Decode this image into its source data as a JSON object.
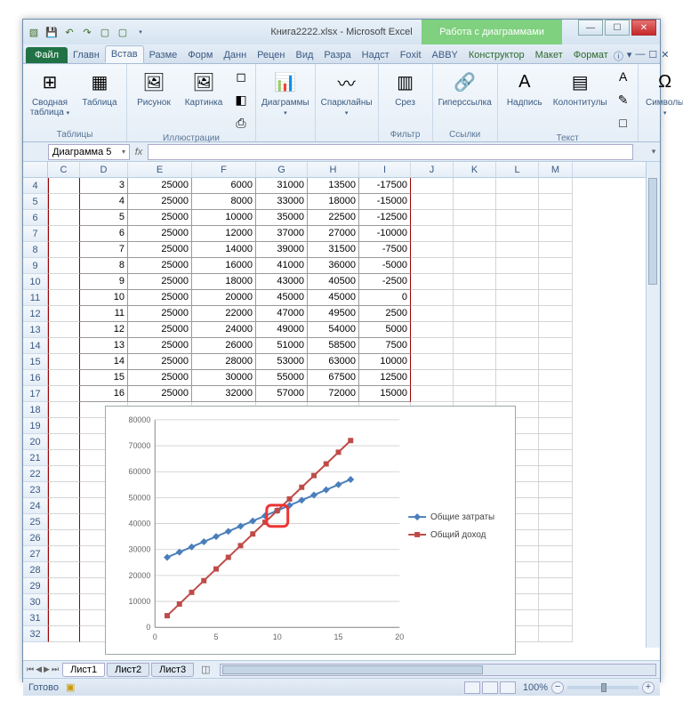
{
  "window": {
    "doc_title": "Книга2222.xlsx - Microsoft Excel",
    "chart_context": "Работа с диаграммами"
  },
  "tabs": {
    "file": "Файл",
    "items": [
      "Главн",
      "Встав",
      "Разме",
      "Форм",
      "Данн",
      "Рецен",
      "Вид",
      "Разра",
      "Надст",
      "Foxit",
      "ABBY"
    ],
    "context": [
      "Конструктор",
      "Макет",
      "Формат"
    ],
    "active_index": 1
  },
  "ribbon": {
    "groups": [
      {
        "label": "Таблицы",
        "items": [
          {
            "name": "pivot",
            "label": "Сводная\nтаблица",
            "icon": "⊞",
            "drop": true
          },
          {
            "name": "table",
            "label": "Таблица",
            "icon": "▦"
          }
        ]
      },
      {
        "label": "Иллюстрации",
        "items": [
          {
            "name": "picture",
            "label": "Рисунок",
            "icon": "🖼"
          },
          {
            "name": "clipart",
            "label": "Картинка",
            "icon": "🖼"
          },
          {
            "name": "shapes",
            "label": "",
            "icon": "◻",
            "small": true
          },
          {
            "name": "smartart",
            "label": "",
            "icon": "◧",
            "small": true
          },
          {
            "name": "screenshot",
            "label": "",
            "icon": "⎙",
            "small": true
          }
        ]
      },
      {
        "label": "",
        "items": [
          {
            "name": "charts",
            "label": "Диаграммы",
            "icon": "📊",
            "drop": true
          }
        ]
      },
      {
        "label": "",
        "items": [
          {
            "name": "sparklines",
            "label": "Спарклайны",
            "icon": "〰",
            "drop": true
          }
        ]
      },
      {
        "label": "Фильтр",
        "items": [
          {
            "name": "slicer",
            "label": "Срез",
            "icon": "▥"
          }
        ]
      },
      {
        "label": "Ссылки",
        "items": [
          {
            "name": "hyperlink",
            "label": "Гиперссылка",
            "icon": "🔗"
          }
        ]
      },
      {
        "label": "Текст",
        "items": [
          {
            "name": "textbox",
            "label": "Надпись",
            "icon": "A"
          },
          {
            "name": "headerfooter",
            "label": "Колонтитулы",
            "icon": "▤"
          },
          {
            "name": "wordart",
            "label": "",
            "icon": "A",
            "small": true
          },
          {
            "name": "sigline",
            "label": "",
            "icon": "✎",
            "small": true
          },
          {
            "name": "object",
            "label": "",
            "icon": "□",
            "small": true
          }
        ]
      },
      {
        "label": "",
        "items": [
          {
            "name": "symbols",
            "label": "Символы",
            "icon": "Ω",
            "drop": true
          }
        ]
      }
    ]
  },
  "namebox": "Диаграмма 5",
  "sheet": {
    "columns": [
      "C",
      "D",
      "E",
      "F",
      "G",
      "H",
      "I",
      "J",
      "K",
      "L",
      "M"
    ],
    "col_classes": [
      "w-C",
      "w-D",
      "w-E",
      "w-F",
      "w-G",
      "w-H",
      "w-I",
      "w-J",
      "w-K",
      "w-L",
      "w-M"
    ],
    "first_row": 4,
    "data_rows": [
      [
        null,
        3,
        25000,
        6000,
        31000,
        13500,
        -17500
      ],
      [
        null,
        4,
        25000,
        8000,
        33000,
        18000,
        -15000
      ],
      [
        null,
        5,
        25000,
        10000,
        35000,
        22500,
        -12500
      ],
      [
        null,
        6,
        25000,
        12000,
        37000,
        27000,
        -10000
      ],
      [
        null,
        7,
        25000,
        14000,
        39000,
        31500,
        -7500
      ],
      [
        null,
        8,
        25000,
        16000,
        41000,
        36000,
        -5000
      ],
      [
        null,
        9,
        25000,
        18000,
        43000,
        40500,
        -2500
      ],
      [
        null,
        10,
        25000,
        20000,
        45000,
        45000,
        0
      ],
      [
        null,
        11,
        25000,
        22000,
        47000,
        49500,
        2500
      ],
      [
        null,
        12,
        25000,
        24000,
        49000,
        54000,
        5000
      ],
      [
        null,
        13,
        25000,
        26000,
        51000,
        58500,
        7500
      ],
      [
        null,
        14,
        25000,
        28000,
        53000,
        63000,
        10000
      ],
      [
        null,
        15,
        25000,
        30000,
        55000,
        67500,
        12500
      ],
      [
        null,
        16,
        25000,
        32000,
        57000,
        72000,
        15000
      ]
    ],
    "blank_rows_after": 15,
    "tabs": [
      "Лист1",
      "Лист2",
      "Лист3"
    ],
    "active_tab": 0
  },
  "chart_data": {
    "type": "line",
    "x": [
      1,
      2,
      3,
      4,
      5,
      6,
      7,
      8,
      9,
      10,
      11,
      12,
      13,
      14,
      15,
      16
    ],
    "series": [
      {
        "name": "Общие затраты",
        "values": [
          27000,
          29000,
          31000,
          33000,
          35000,
          37000,
          39000,
          41000,
          43000,
          45000,
          47000,
          49000,
          51000,
          53000,
          55000,
          57000
        ],
        "color": "#4a7ebb",
        "marker": "diamond"
      },
      {
        "name": "Общий доход",
        "values": [
          4500,
          9000,
          13500,
          18000,
          22500,
          27000,
          31500,
          36000,
          40500,
          45000,
          49500,
          54000,
          58500,
          63000,
          67500,
          72000
        ],
        "color": "#be4b48",
        "marker": "square"
      }
    ],
    "xlim": [
      0,
      20
    ],
    "ylim": [
      0,
      80000
    ],
    "xticks": [
      0,
      5,
      10,
      15,
      20
    ],
    "yticks": [
      0,
      10000,
      20000,
      30000,
      40000,
      50000,
      60000,
      70000,
      80000
    ]
  },
  "status": {
    "ready": "Готово",
    "zoom": "100%"
  }
}
